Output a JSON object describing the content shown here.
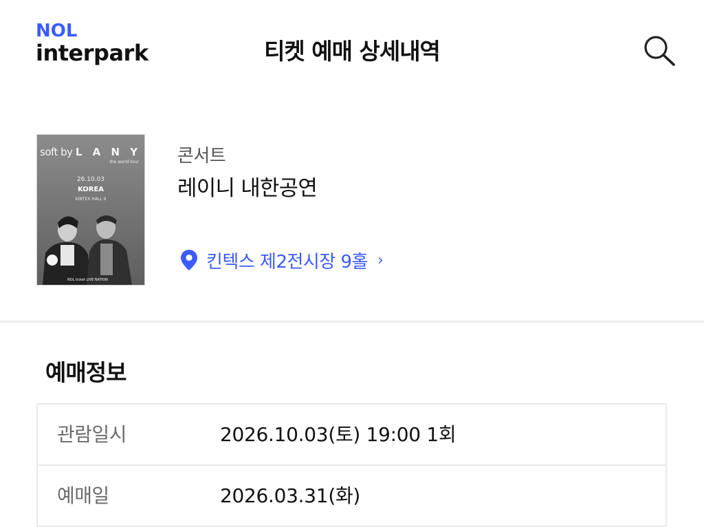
{
  "header": {
    "logo_line1": "NOL",
    "logo_line2": "interpark",
    "title": "티켓 예매 상세내역",
    "search_icon": "search-icon"
  },
  "event": {
    "poster": {
      "line1_prefix": "soft by",
      "line1_artist": "L A N Y",
      "subtitle": "the world tour",
      "date": "26.10.03",
      "country": "KOREA",
      "venue": "KINTEX HALL 9",
      "footer": "NOL ticket   LIVE NATION"
    },
    "category": "콘서트",
    "name": "레이니 내한공연",
    "venue_icon": "location-pin-icon",
    "venue": "킨텍스 제2전시장 9홀",
    "venue_chevron": "›"
  },
  "booking_info": {
    "title": "예매정보",
    "rows": [
      {
        "label": "관람일시",
        "value": "2026.10.03(토) 19:00 1회"
      },
      {
        "label": "예매일",
        "value": "2026.03.31(화)"
      }
    ]
  },
  "colors": {
    "brand_blue": "#3b5bff",
    "text_primary": "#111111",
    "text_secondary": "#6b6b6b",
    "divider": "#ececec"
  }
}
